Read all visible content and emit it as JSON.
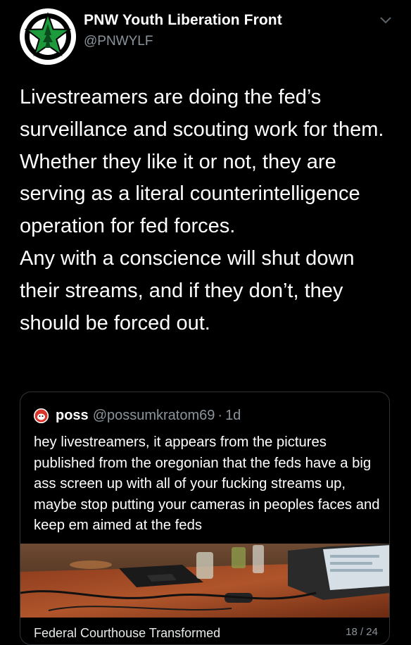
{
  "tweet": {
    "author": {
      "display_name": "PNW Youth Liberation Front",
      "handle": "@PNWYLF",
      "avatar": "green-star-logo"
    },
    "text": "Livestreamers are doing the fed’s surveillance and scouting work for them. Whether they like it or not, they are serving as a literal counterintelligence operation for fed forces.\nAny with a conscience will shut down their streams, and if they don’t, they should be forced out.",
    "menu_icon": "chevron-down-icon"
  },
  "quote": {
    "author": {
      "display_name": "poss",
      "handle": "@possumkratom69",
      "separator": "·",
      "time": "1d",
      "avatar": "possum-avatar"
    },
    "text": "hey livestreamers, it appears from the pictures published from the oregonian that the feds have a big ass screen up with all of your fucking streams up, maybe stop putting your cameras in peoples faces and keep em aimed at the feds",
    "media": {
      "link_title": "Federal Courthouse Transformed",
      "page_counter": "18 / 24"
    }
  },
  "colors": {
    "background": "#000000",
    "secondary_text": "#8b939b",
    "card_border": "#2f3336",
    "logo_green": "#1d9a3c"
  }
}
